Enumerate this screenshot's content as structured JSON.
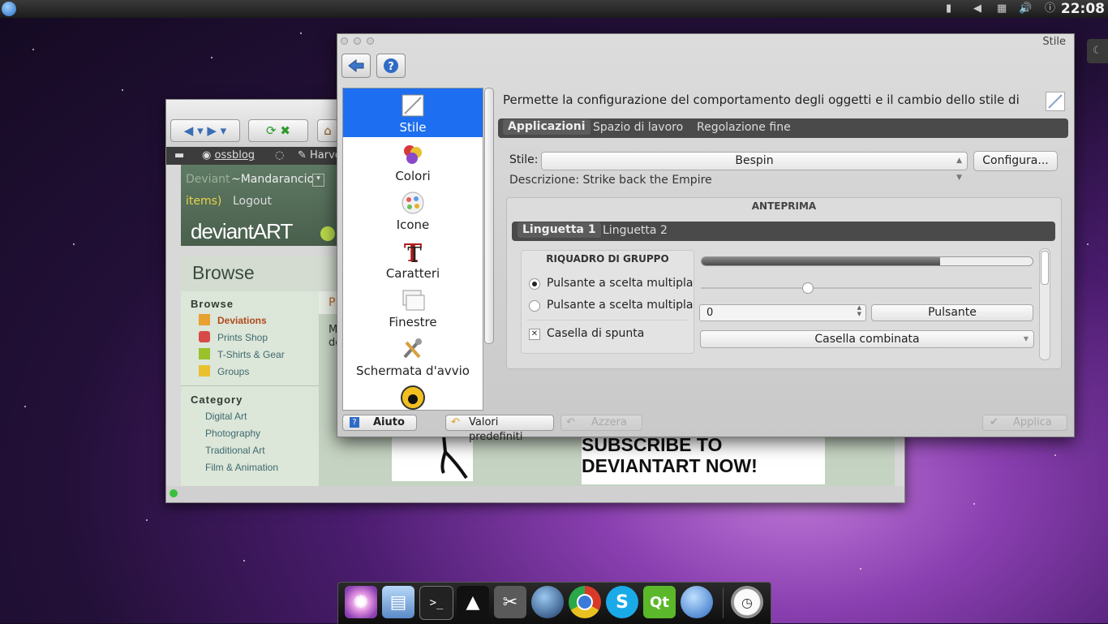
{
  "top_panel": {
    "clock": "22:08"
  },
  "browser": {
    "bookmarks": [
      "ossblog",
      "Harve"
    ],
    "da_nav_user": "Deviant",
    "da_nav_username": "~Mandarancio",
    "da_nav_items": "items)",
    "da_nav_logout": "Logout",
    "logo": "deviantART",
    "browse_title": "Browse",
    "side_browse_head": "Browse",
    "side_links": [
      "Deviations",
      "Prints Shop",
      "T-Shirts & Gear",
      "Groups"
    ],
    "side_category_head": "Category",
    "side_categories": [
      "Digital Art",
      "Photography",
      "Traditional Art",
      "Film & Animation"
    ],
    "main_tab_letter": "P",
    "main_text": "M",
    "main_text2": "de",
    "subscribe_line1": "SUBSCRIBE TO",
    "subscribe_line2": "DEVIANTART NOW!"
  },
  "window": {
    "title": "Stile",
    "sidebar_items": [
      {
        "label": "Stile",
        "icon": "style-icon",
        "selected": true
      },
      {
        "label": "Colori",
        "icon": "colors-icon",
        "selected": false
      },
      {
        "label": "Icone",
        "icon": "icons-icon",
        "selected": false
      },
      {
        "label": "Caratteri",
        "icon": "fonts-icon",
        "selected": false
      },
      {
        "label": "Finestre",
        "icon": "windows-icon",
        "selected": false
      },
      {
        "label": "Schermata d'avvio",
        "icon": "splash-screen-icon",
        "selected": false
      }
    ],
    "description": "Permette la configurazione del comportamento degli oggetti e il cambio dello stile di",
    "tabs": [
      "Applicazioni",
      "Spazio di lavoro",
      "Regolazione fine"
    ],
    "style_label": "Stile:",
    "style_value": "Bespin",
    "configure_button": "Configura...",
    "style_description": "Descrizione: Strike back the Empire",
    "preview": {
      "title": "ANTEPRIMA",
      "tabs": [
        "Linguetta 1",
        "Linguetta 2"
      ],
      "groupbox_title": "RIQUADRO DI GRUPPO",
      "radio1": "Pulsante a scelta multipla",
      "radio2": "Pulsante a scelta multipla",
      "checkbox": "Casella di spunta",
      "progress": 0.72,
      "slider": 0.32,
      "spin_value": "0",
      "button": "Pulsante",
      "combo": "Casella combinata"
    },
    "buttons": {
      "help": "Aiuto",
      "defaults": "Valori predefiniti",
      "reset": "Azzera",
      "apply": "Applica"
    }
  },
  "dock_icons": [
    "system-settings-icon",
    "file-manager-icon",
    "terminal-icon",
    "inkscape-icon",
    "tools-icon",
    "globe-icon",
    "chrome-icon",
    "skype-icon",
    "qt-creator-icon",
    "network-icon",
    "clock-icon"
  ],
  "colors": {
    "selection": "#1d6ef0",
    "tabbar": "#4a4a4a"
  }
}
